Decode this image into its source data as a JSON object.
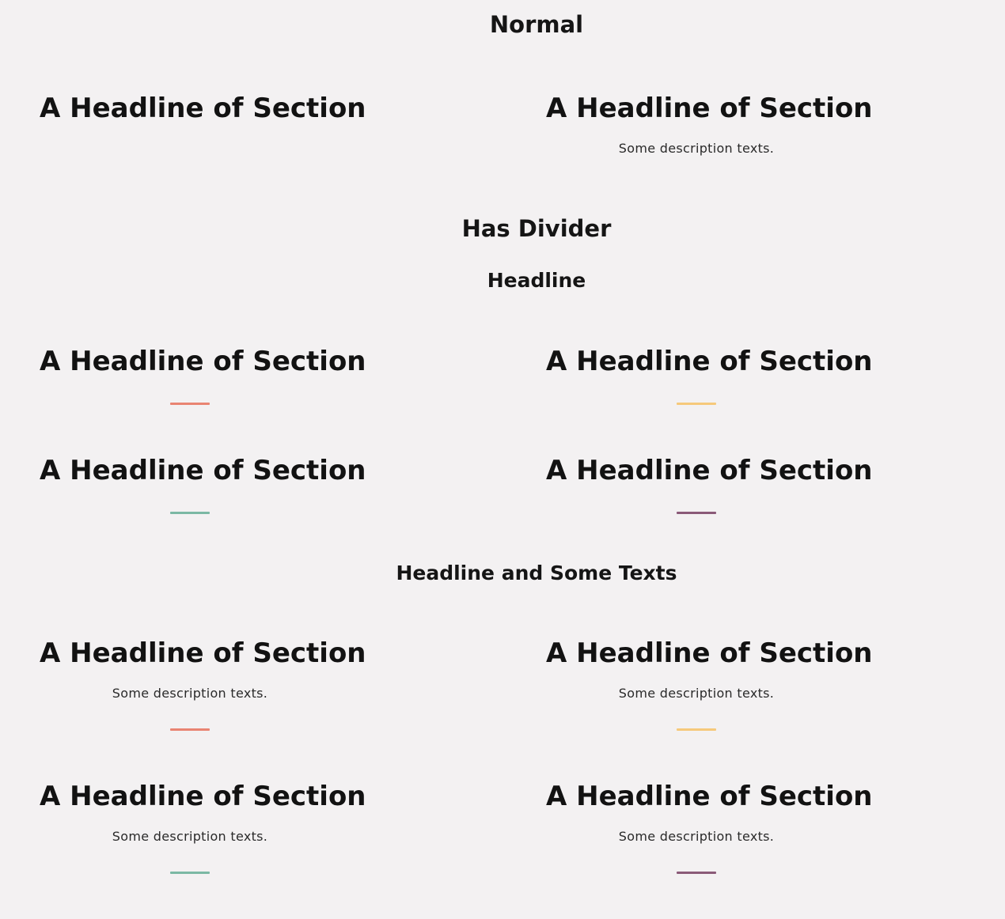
{
  "sections": {
    "normal": {
      "title": "Normal"
    },
    "has_divider": {
      "title": "Has Divider",
      "headline_group": {
        "title": "Headline"
      },
      "headline_text_group": {
        "title": "Headline and Some Texts"
      }
    }
  },
  "headline_text": "A Headline of Section",
  "description_text": "Some description texts.",
  "colors": {
    "background": "#f3f1f2",
    "divider_coral": "#e98472",
    "divider_yellow": "#f6c97b",
    "divider_green": "#7bb8a4",
    "divider_purple": "#8a5a78"
  }
}
